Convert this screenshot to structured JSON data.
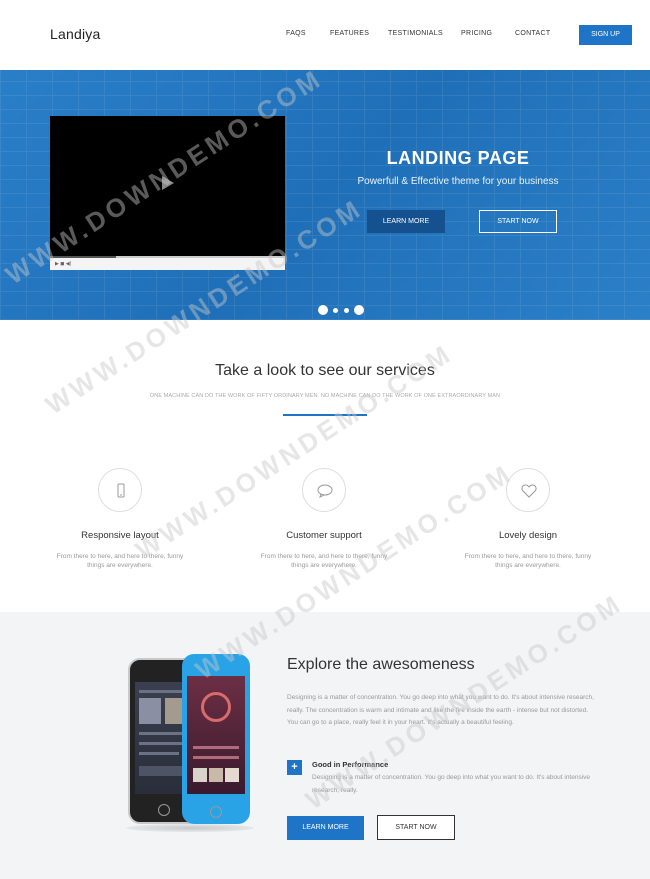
{
  "header": {
    "logo": "Landiya",
    "nav": [
      "FAQS",
      "FEATURES",
      "TESTIMONIALS",
      "PRICING",
      "CONTACT"
    ],
    "signup_label": "SIGN UP"
  },
  "hero": {
    "title": "LANDING PAGE",
    "subtitle": "Powerfull & Effective theme for your business",
    "learn_more_label": "LEARN MORE",
    "start_now_label": "START NOW",
    "slide_count": 4
  },
  "services": {
    "title": "Take a look to see our services",
    "subtitle": "ONE MACHINE CAN DO THE WORK OF FIFTY ORDINARY MEN. NO MACHINE CAN DO THE WORK OF ONE EXTRAORDINARY MAN",
    "features": [
      {
        "icon": "mobile-icon",
        "title": "Responsive layout",
        "text": "From there to here, and here to there, funny things are everywhere."
      },
      {
        "icon": "chat-bubble-icon",
        "title": "Customer support",
        "text": "From there to here, and here to there, funny things are everywhere."
      },
      {
        "icon": "heart-icon",
        "title": "Lovely design",
        "text": "From there to here, and here to there, funny things are everywhere."
      }
    ]
  },
  "explore": {
    "title": "Explore the awesomeness",
    "text": "Designing is a matter of concentration. You go deep into what you want to do. It's about intensive research, really. The concentration is warm and intimate and like the fire inside the earth - intense but not distorted. You can go to a place, really feel it in your heart. It's actually a beautiful feeling.",
    "performance": {
      "icon": "plus-icon",
      "title": "Good in Performance",
      "text": "Designing is a matter of concentration. You go deep into what you want to do. It's about intensive research, really."
    },
    "learn_more_label": "LEARN MORE",
    "start_now_label": "START NOW"
  },
  "watermark": "WWW.DOWNDEMO.COM",
  "colors": {
    "accent": "#1e74c7",
    "hero_bg": "#2577c3",
    "dark_button": "#14518e",
    "section_bg": "#f3f4f6"
  }
}
